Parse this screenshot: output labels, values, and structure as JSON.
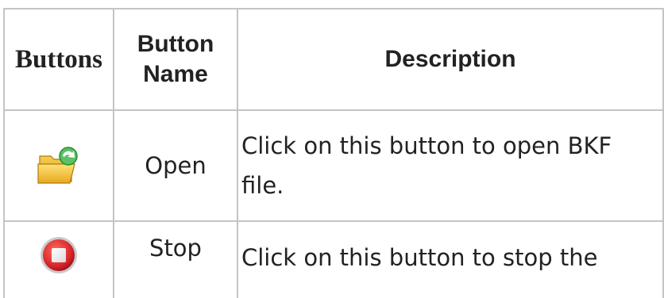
{
  "table": {
    "headers": [
      "Buttons",
      "Button\nName",
      "Description"
    ],
    "header_buttons": "Buttons",
    "header_name_line1": "Button",
    "header_name_line2": "Name",
    "header_description": "Description",
    "rows": [
      {
        "icon": "open-folder-icon",
        "name": "Open",
        "description": "Click on this button to open BKF file."
      },
      {
        "icon": "stop-icon",
        "name": "Stop",
        "description": "Click on this button to stop the"
      }
    ]
  },
  "colors": {
    "border": "#c4c4c4",
    "text": "#222222",
    "folder": "#f2c22e",
    "arrow": "#3aa845",
    "stop_red": "#d9262a"
  }
}
